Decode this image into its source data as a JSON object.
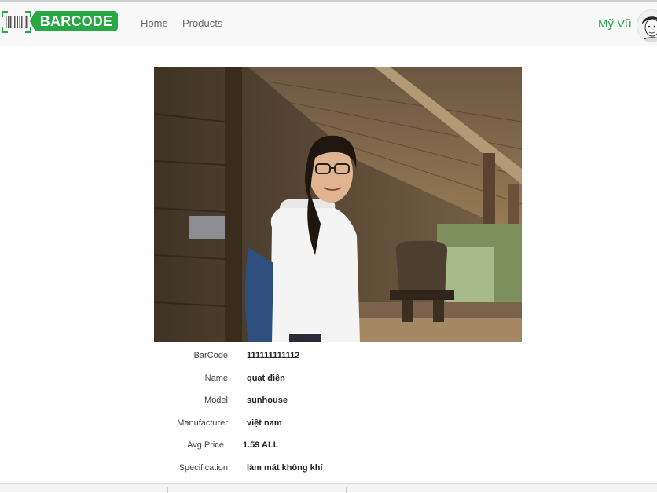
{
  "brand": {
    "logo_text": "BARCODE",
    "accent_color": "#28a745"
  },
  "nav": {
    "items": [
      {
        "label": "Home"
      },
      {
        "label": "Products"
      }
    ]
  },
  "user": {
    "name": "Mỹ Vũ"
  },
  "product": {
    "image_alt": "",
    "fields": [
      {
        "label": "BarCode",
        "value": "111111111112"
      },
      {
        "label": "Name",
        "value": "quạt điện"
      },
      {
        "label": "Model",
        "value": "sunhouse"
      },
      {
        "label": "Manufacturer",
        "value": "việt nam"
      },
      {
        "label": "Avg Price",
        "value": "1.59 ALL"
      },
      {
        "label": "Specification",
        "value": "làm mát không khí"
      }
    ]
  }
}
